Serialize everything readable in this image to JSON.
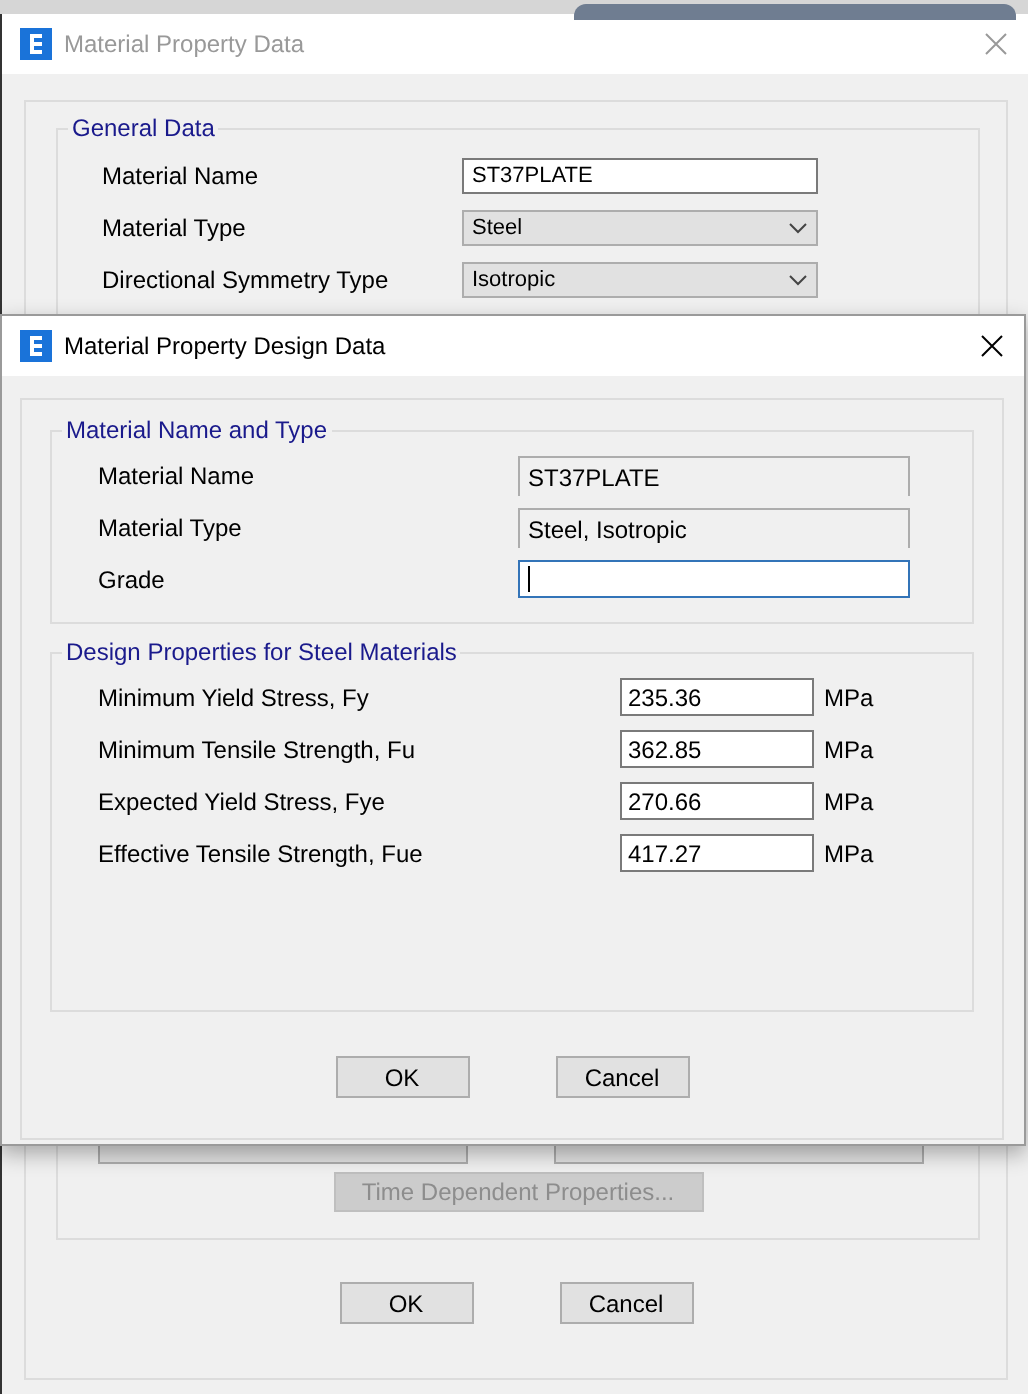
{
  "background_window": {
    "title": "Material Property Data",
    "active": false,
    "general_data": {
      "title": "General Data",
      "fields": [
        {
          "label": "Material Name",
          "value": "ST37PLATE",
          "kind": "text"
        },
        {
          "label": "Material Type",
          "value": "Steel",
          "kind": "dropdown"
        },
        {
          "label": "Directional Symmetry Type",
          "value": "Isotropic",
          "kind": "dropdown"
        }
      ]
    },
    "time_dependent_button": {
      "label": "Time Dependent Properties...",
      "disabled": true
    },
    "buttons": [
      {
        "label": "OK"
      },
      {
        "label": "Cancel"
      }
    ]
  },
  "dialog": {
    "title": "Material Property Design Data",
    "active": true,
    "name_and_type": {
      "title": "Material Name and Type",
      "fields": [
        {
          "label": "Material Name",
          "value": "ST37PLATE",
          "kind": "readonly"
        },
        {
          "label": "Material Type",
          "value": "Steel, Isotropic",
          "kind": "readonly"
        },
        {
          "label": "Grade",
          "kind": "input",
          "focused": true
        }
      ]
    },
    "design_properties": {
      "title": "Design Properties for Steel Materials",
      "rows": [
        {
          "label": "Minimum Yield Stress, Fy",
          "value": "235.36",
          "unit": "MPa"
        },
        {
          "label": "Minimum Tensile Strength, Fu",
          "value": "362.85",
          "unit": "MPa"
        },
        {
          "label": "Expected Yield Stress, Fye",
          "value": "270.66",
          "unit": "MPa"
        },
        {
          "label": "Effective Tensile Strength, Fue",
          "value": "417.27",
          "unit": "MPa"
        }
      ]
    },
    "buttons": [
      {
        "label": "OK"
      },
      {
        "label": "Cancel"
      }
    ]
  }
}
